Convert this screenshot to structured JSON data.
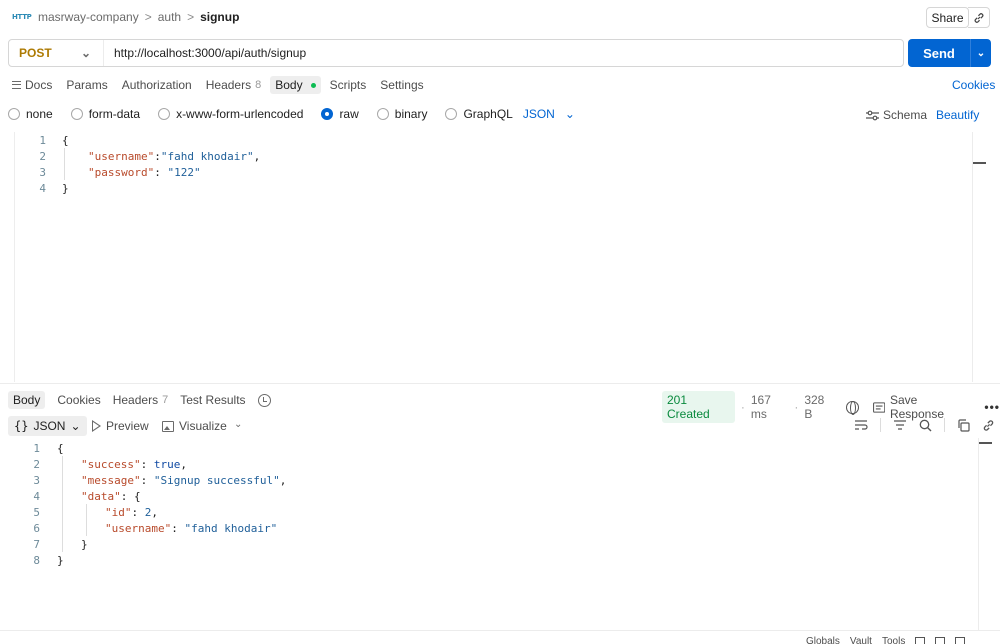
{
  "header": {
    "app_icon_text": "HTTP",
    "breadcrumbs": [
      "masrway-company",
      "auth"
    ],
    "current": "signup",
    "separator": ">",
    "share_label": "Share"
  },
  "request": {
    "method": "POST",
    "url": "http://localhost:3000/api/auth/signup",
    "send_label": "Send",
    "tabs": [
      {
        "label": "Docs"
      },
      {
        "label": "Params"
      },
      {
        "label": "Authorization"
      },
      {
        "label": "Headers",
        "count": "8"
      },
      {
        "label": "Body",
        "active": true
      },
      {
        "label": "Scripts"
      },
      {
        "label": "Settings"
      }
    ],
    "cookies_label": "Cookies",
    "body_types": [
      "none",
      "form-data",
      "x-www-form-urlencoded",
      "raw",
      "binary",
      "GraphQL"
    ],
    "selected_body_type": "raw",
    "format": "JSON",
    "schema_label": "Schema",
    "beautify_label": "Beautify",
    "body_lines": [
      {
        "n": "1",
        "parts": [
          [
            "punc",
            "{"
          ]
        ]
      },
      {
        "n": "2",
        "parts": [
          [
            "key",
            "\"username\""
          ],
          [
            "punc",
            ":"
          ],
          [
            "str",
            "\"fahd khodair\""
          ],
          [
            "punc",
            ","
          ]
        ]
      },
      {
        "n": "3",
        "parts": [
          [
            "key",
            "\"password\""
          ],
          [
            "punc",
            ": "
          ],
          [
            "str",
            "\"122\""
          ]
        ]
      },
      {
        "n": "4",
        "parts": [
          [
            "punc",
            "}"
          ]
        ]
      }
    ]
  },
  "response": {
    "tabs": [
      {
        "label": "Body",
        "active": true
      },
      {
        "label": "Cookies"
      },
      {
        "label": "Headers",
        "count": "7"
      },
      {
        "label": "Test Results"
      }
    ],
    "status": "201 Created",
    "time": "167 ms",
    "size": "328 B",
    "save_label": "Save Response",
    "more_label": "•••",
    "format_label": "JSON",
    "preview_label": "Preview",
    "visualize_label": "Visualize",
    "body_lines": [
      {
        "n": "1",
        "indent": 0,
        "parts": [
          [
            "punc",
            "{"
          ]
        ]
      },
      {
        "n": "2",
        "indent": 1,
        "parts": [
          [
            "key",
            "\"success\""
          ],
          [
            "punc",
            ": "
          ],
          [
            "bool",
            "true"
          ],
          [
            "punc",
            ","
          ]
        ]
      },
      {
        "n": "3",
        "indent": 1,
        "parts": [
          [
            "key",
            "\"message\""
          ],
          [
            "punc",
            ": "
          ],
          [
            "str",
            "\"Signup successful\""
          ],
          [
            "punc",
            ","
          ]
        ]
      },
      {
        "n": "4",
        "indent": 1,
        "parts": [
          [
            "key",
            "\"data\""
          ],
          [
            "punc",
            ": {"
          ]
        ]
      },
      {
        "n": "5",
        "indent": 2,
        "parts": [
          [
            "key",
            "\"id\""
          ],
          [
            "punc",
            ": "
          ],
          [
            "num",
            "2"
          ],
          [
            "punc",
            ","
          ]
        ]
      },
      {
        "n": "6",
        "indent": 2,
        "parts": [
          [
            "key",
            "\"username\""
          ],
          [
            "punc",
            ": "
          ],
          [
            "str",
            "\"fahd khodair\""
          ]
        ]
      },
      {
        "n": "7",
        "indent": 1,
        "parts": [
          [
            "punc",
            "}"
          ]
        ]
      },
      {
        "n": "8",
        "indent": 0,
        "parts": [
          [
            "punc",
            "}"
          ]
        ]
      }
    ]
  },
  "footer": {
    "items": [
      "Globals",
      "Vault",
      "Tools"
    ]
  },
  "colors": {
    "accent": "#0265d2",
    "method": "#ad7a03",
    "status_ok": "#0a8a3e",
    "json_key": "#b84a2b",
    "json_string": "#1f5f99"
  }
}
